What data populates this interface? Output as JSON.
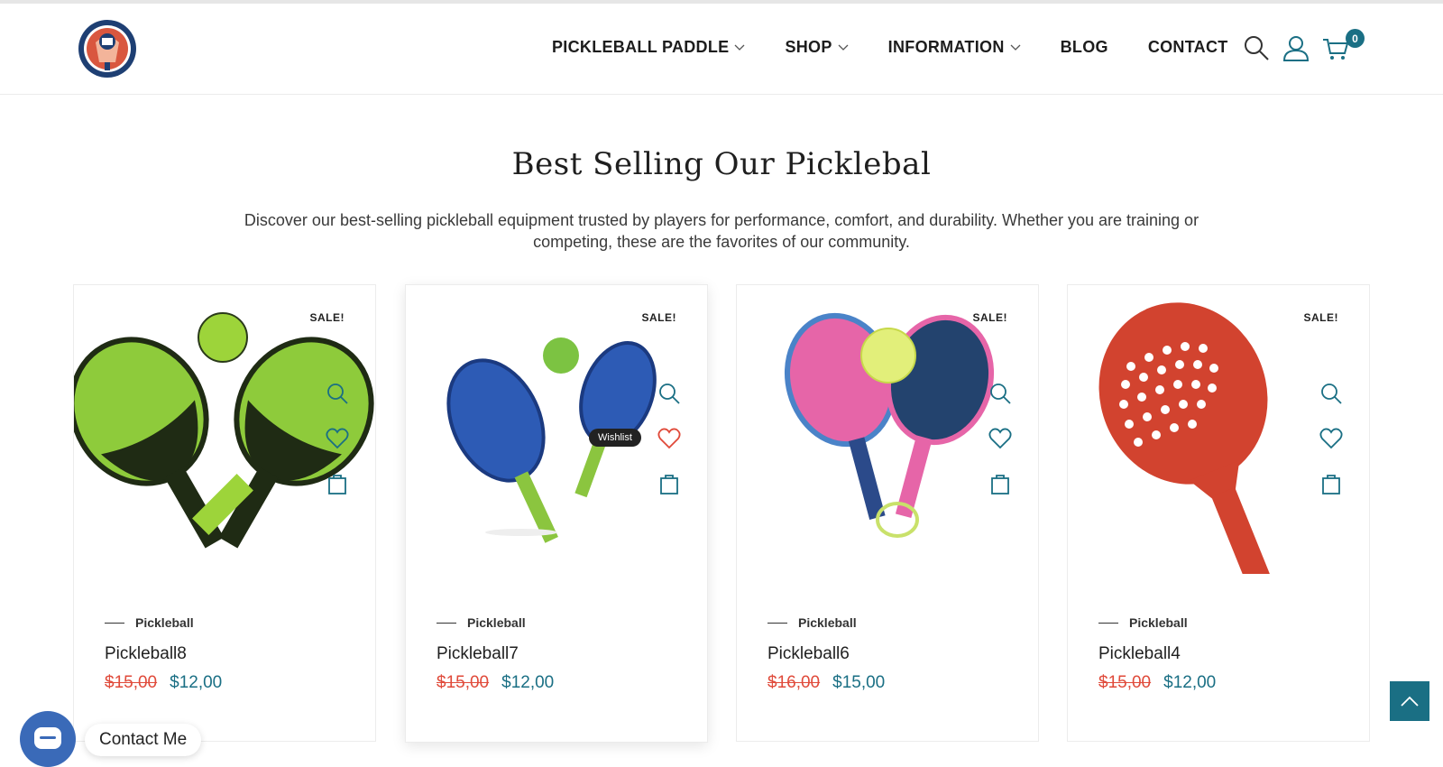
{
  "nav": {
    "items": [
      {
        "label": "PICKLEBALL PADDLE",
        "dropdown": true
      },
      {
        "label": "SHOP",
        "dropdown": true
      },
      {
        "label": "INFORMATION",
        "dropdown": true
      },
      {
        "label": "BLOG",
        "dropdown": false
      },
      {
        "label": "CONTACT",
        "dropdown": false
      }
    ],
    "cart_count": "0"
  },
  "section": {
    "title": "Best Selling Our Picklebal",
    "description": "Discover our best-selling pickleball equipment trusted by players for performance, comfort, and durability. Whether you are training or competing, these are the favorites of our community."
  },
  "products": [
    {
      "badge": "SALE!",
      "category": "Pickleball",
      "name": "Pickleball8",
      "old_price": "$15,00",
      "new_price": "$12,00"
    },
    {
      "badge": "SALE!",
      "category": "Pickleball",
      "name": "Pickleball7",
      "old_price": "$15,00",
      "new_price": "$12,00",
      "tooltip": "Wishlist"
    },
    {
      "badge": "SALE!",
      "category": "Pickleball",
      "name": "Pickleball6",
      "old_price": "$16,00",
      "new_price": "$15,00"
    },
    {
      "badge": "SALE!",
      "category": "Pickleball",
      "name": "Pickleball4",
      "old_price": "$15,00",
      "new_price": "$12,00"
    }
  ],
  "contact_widget": {
    "label": "Contact Me"
  },
  "colors": {
    "accent": "#1a6f84",
    "sale_red": "#e04a3a",
    "chat_blue": "#3a6ab8"
  },
  "icons": [
    "search-icon",
    "user-icon",
    "cart-icon",
    "quick-view-icon",
    "wishlist-heart-icon",
    "add-to-cart-bag-icon",
    "chevron-up-icon",
    "chat-icon"
  ]
}
